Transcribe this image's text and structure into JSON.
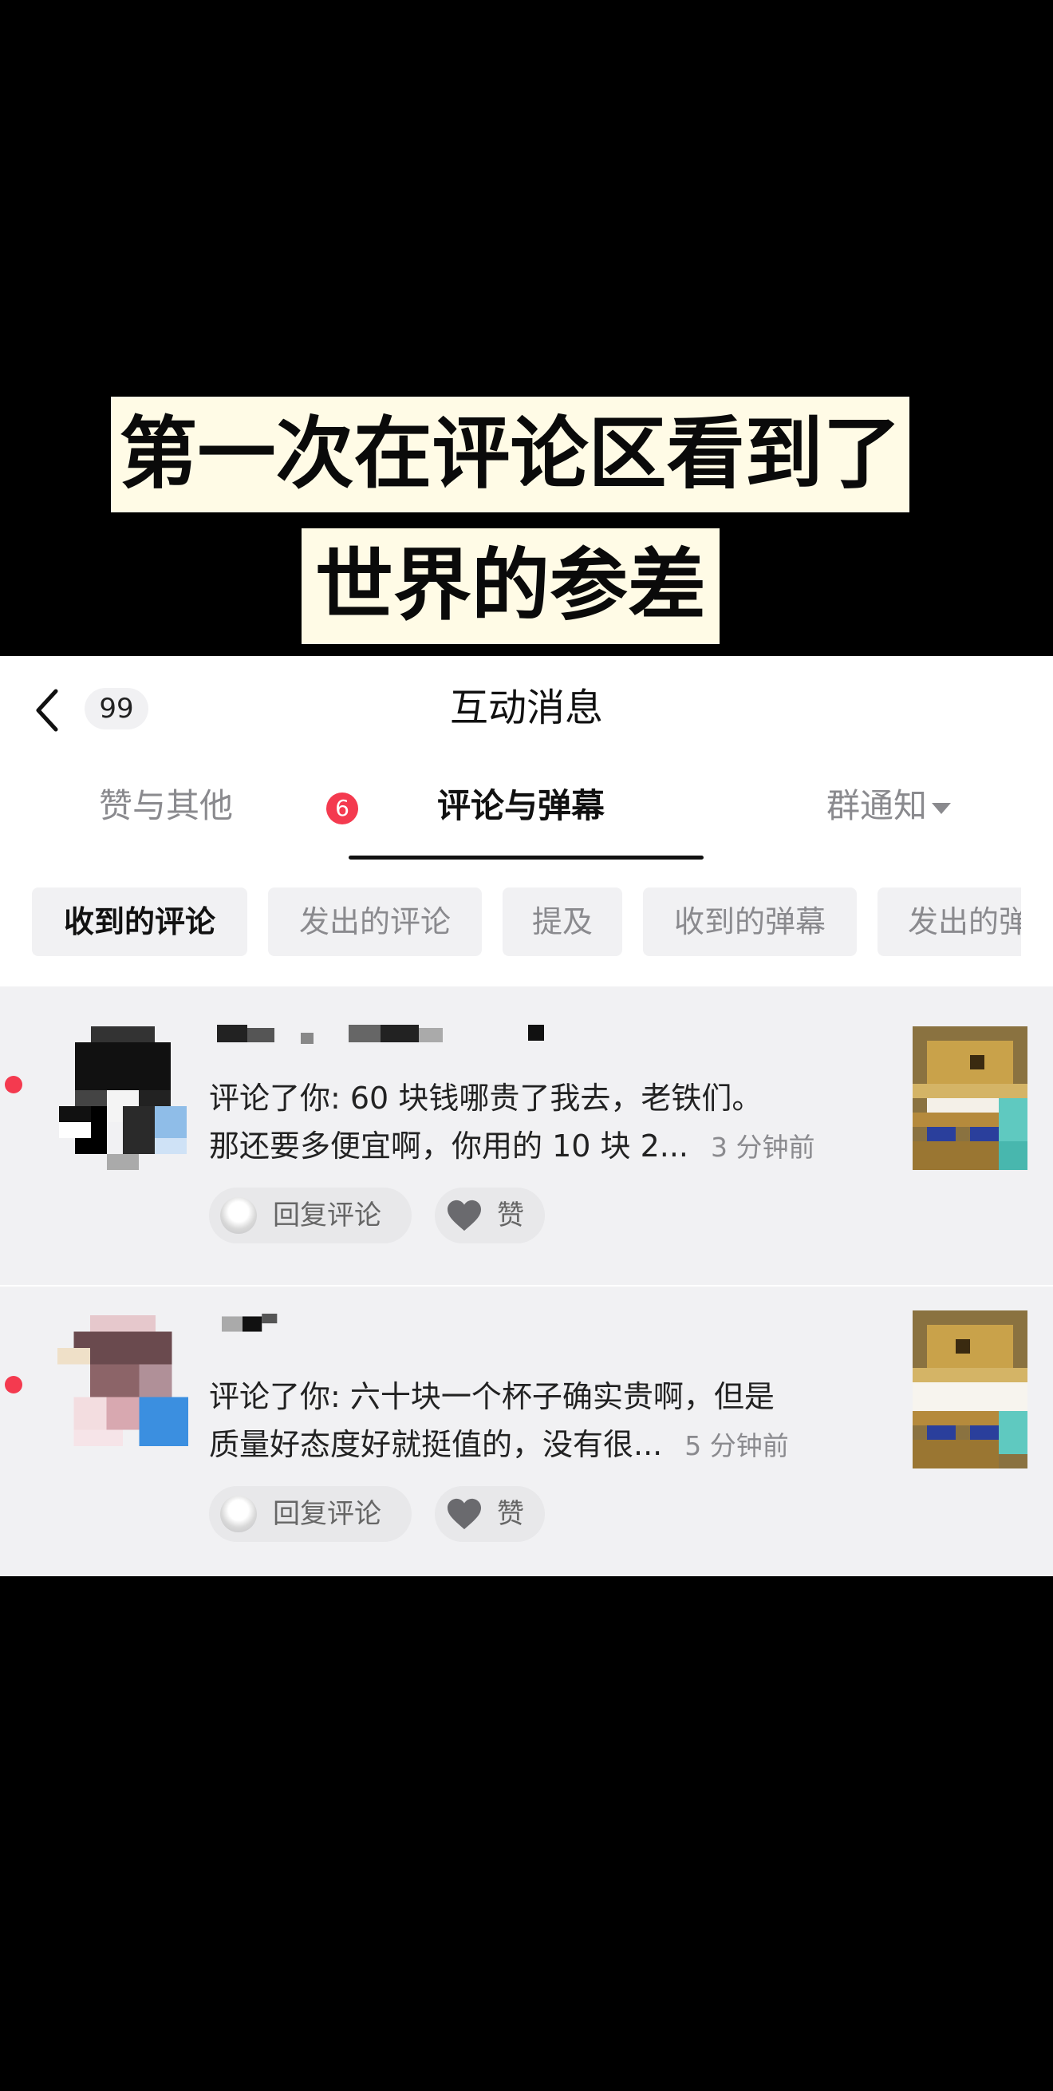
{
  "caption": {
    "line1": "第一次在评论区看到了",
    "line2": "世界的参差"
  },
  "header": {
    "back_badge": "99",
    "title": "互动消息"
  },
  "tabs": [
    {
      "label": "赞与其他",
      "badge": "6"
    },
    {
      "label": "评论与弹幕"
    },
    {
      "label": "群通知"
    }
  ],
  "filters": [
    "收到的评论",
    "发出的评论",
    "提及",
    "收到的弹幕",
    "发出的弹"
  ],
  "comments": [
    {
      "line1": "评论了你: 60 块钱哪贵了我去，老铁们。",
      "line2": "那还要多便宜啊，你用的 10 块 2...",
      "time": "3 分钟前",
      "reply_label": "回复评论",
      "like_label": "赞"
    },
    {
      "line1": "评论了你: 六十块一个杯子确实贵啊，但是",
      "line2": "质量好态度好就挺值的，没有很...",
      "time": "5 分钟前",
      "reply_label": "回复评论",
      "like_label": "赞"
    }
  ]
}
